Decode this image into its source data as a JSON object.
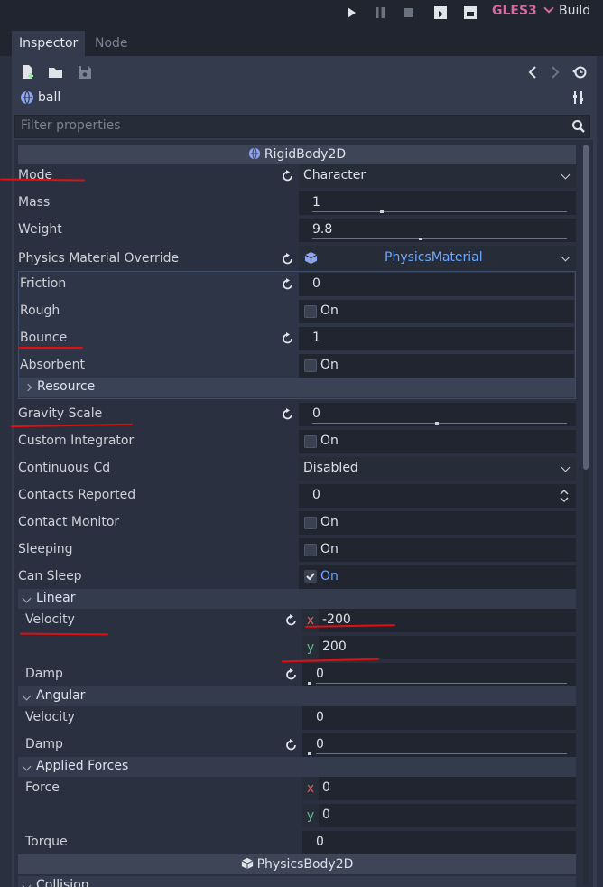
{
  "top_bar": {
    "renderer": "GLES3",
    "build": "Build"
  },
  "tabs": [
    {
      "label": "Inspector"
    },
    {
      "label": "Node"
    }
  ],
  "object_name": "ball",
  "filter_placeholder": "Filter properties",
  "rigidbody_header": "RigidBody2D",
  "physicsbody_header": "PhysicsBody2D",
  "properties": {
    "mode": {
      "label": "Mode",
      "value": "Character"
    },
    "mass": {
      "label": "Mass",
      "value": "1"
    },
    "weight": {
      "label": "Weight",
      "value": "9.8"
    },
    "physics_material_override": {
      "label": "Physics Material Override",
      "value": "PhysicsMaterial"
    },
    "friction": {
      "label": "Friction",
      "value": "0"
    },
    "rough": {
      "label": "Rough",
      "value": "On"
    },
    "bounce": {
      "label": "Bounce",
      "value": "1"
    },
    "absorbent": {
      "label": "Absorbent",
      "value": "On"
    },
    "resource": {
      "label": "Resource"
    },
    "gravity_scale": {
      "label": "Gravity Scale",
      "value": "0"
    },
    "custom_integrator": {
      "label": "Custom Integrator",
      "value": "On"
    },
    "continuous_cd": {
      "label": "Continuous Cd",
      "value": "Disabled"
    },
    "contacts_reported": {
      "label": "Contacts Reported",
      "value": "0"
    },
    "contact_monitor": {
      "label": "Contact Monitor",
      "value": "On"
    },
    "sleeping": {
      "label": "Sleeping",
      "value": "On"
    },
    "can_sleep": {
      "label": "Can Sleep",
      "value": "On"
    }
  },
  "linear": {
    "title": "Linear",
    "velocity_label": "Velocity",
    "velocity_x": "-200",
    "velocity_y": "200",
    "damp_label": "Damp",
    "damp": "0"
  },
  "angular": {
    "title": "Angular",
    "velocity_label": "Velocity",
    "velocity": "0",
    "damp_label": "Damp",
    "damp": "0"
  },
  "applied_forces": {
    "title": "Applied Forces",
    "force_label": "Force",
    "force_x": "0",
    "force_y": "0",
    "torque_label": "Torque",
    "torque": "0"
  },
  "collision": {
    "title": "Collision"
  },
  "axis_labels": {
    "x": "x",
    "y": "y"
  },
  "colors": {
    "accent": "#6fa8ff",
    "renderer": "#d46aa0",
    "annotation": "#e01010",
    "axis_x": "#d9605a",
    "axis_y": "#5fb98a"
  },
  "icons": [
    "play-icon",
    "pause-icon",
    "stop-icon",
    "play-scene-icon",
    "play-custom-icon",
    "new-script-icon",
    "open-icon",
    "save-icon",
    "history-back-icon",
    "history-forward-icon",
    "object-history-icon",
    "node-icon",
    "tool-icon",
    "search-icon",
    "revert-icon",
    "checkbox-icon",
    "resource-icon",
    "chevron-icon"
  ]
}
